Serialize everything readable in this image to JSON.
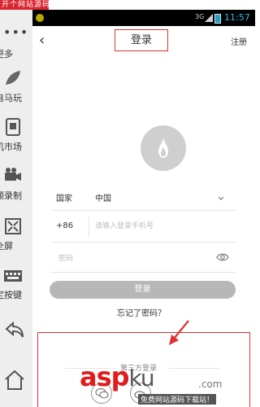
{
  "top_strip": {
    "text": "开个网站源码"
  },
  "side_panel": {
    "dots": "•••",
    "items": [
      {
        "label": "更多",
        "icon": "more-dots-icon"
      },
      {
        "label": "自马玩",
        "icon": "leaf-icon"
      },
      {
        "label": "机市场",
        "icon": "store-icon"
      },
      {
        "label": "频录制",
        "icon": "camera-icon"
      },
      {
        "label": "全屏",
        "icon": "fullscreen-icon"
      },
      {
        "label": "定按键",
        "icon": "keyboard-icon"
      },
      {
        "label": "",
        "icon": "back-arrow-icon"
      },
      {
        "label": "",
        "icon": "home-icon"
      }
    ]
  },
  "status_bar": {
    "network": "3G",
    "time": "11:57"
  },
  "header": {
    "back_icon": "‹",
    "title": "登录",
    "register": "注册"
  },
  "form": {
    "country_label": "国家",
    "country_value": "中国",
    "phone_code": "+86",
    "phone_placeholder": "请输入登录手机号",
    "password_placeholder": "密码"
  },
  "login_button": "登录",
  "forgot_password": "忘记了密码？",
  "third_party": {
    "title": "第三方登录"
  },
  "watermark": {
    "logo": "asp",
    "logo_tail": "ku",
    "domain": ".com",
    "tagline": "免费网站源码下载站！"
  },
  "colors": {
    "accent_red": "#e03030",
    "status_time": "#33b5e5",
    "login_button": "#b7b7b7"
  }
}
